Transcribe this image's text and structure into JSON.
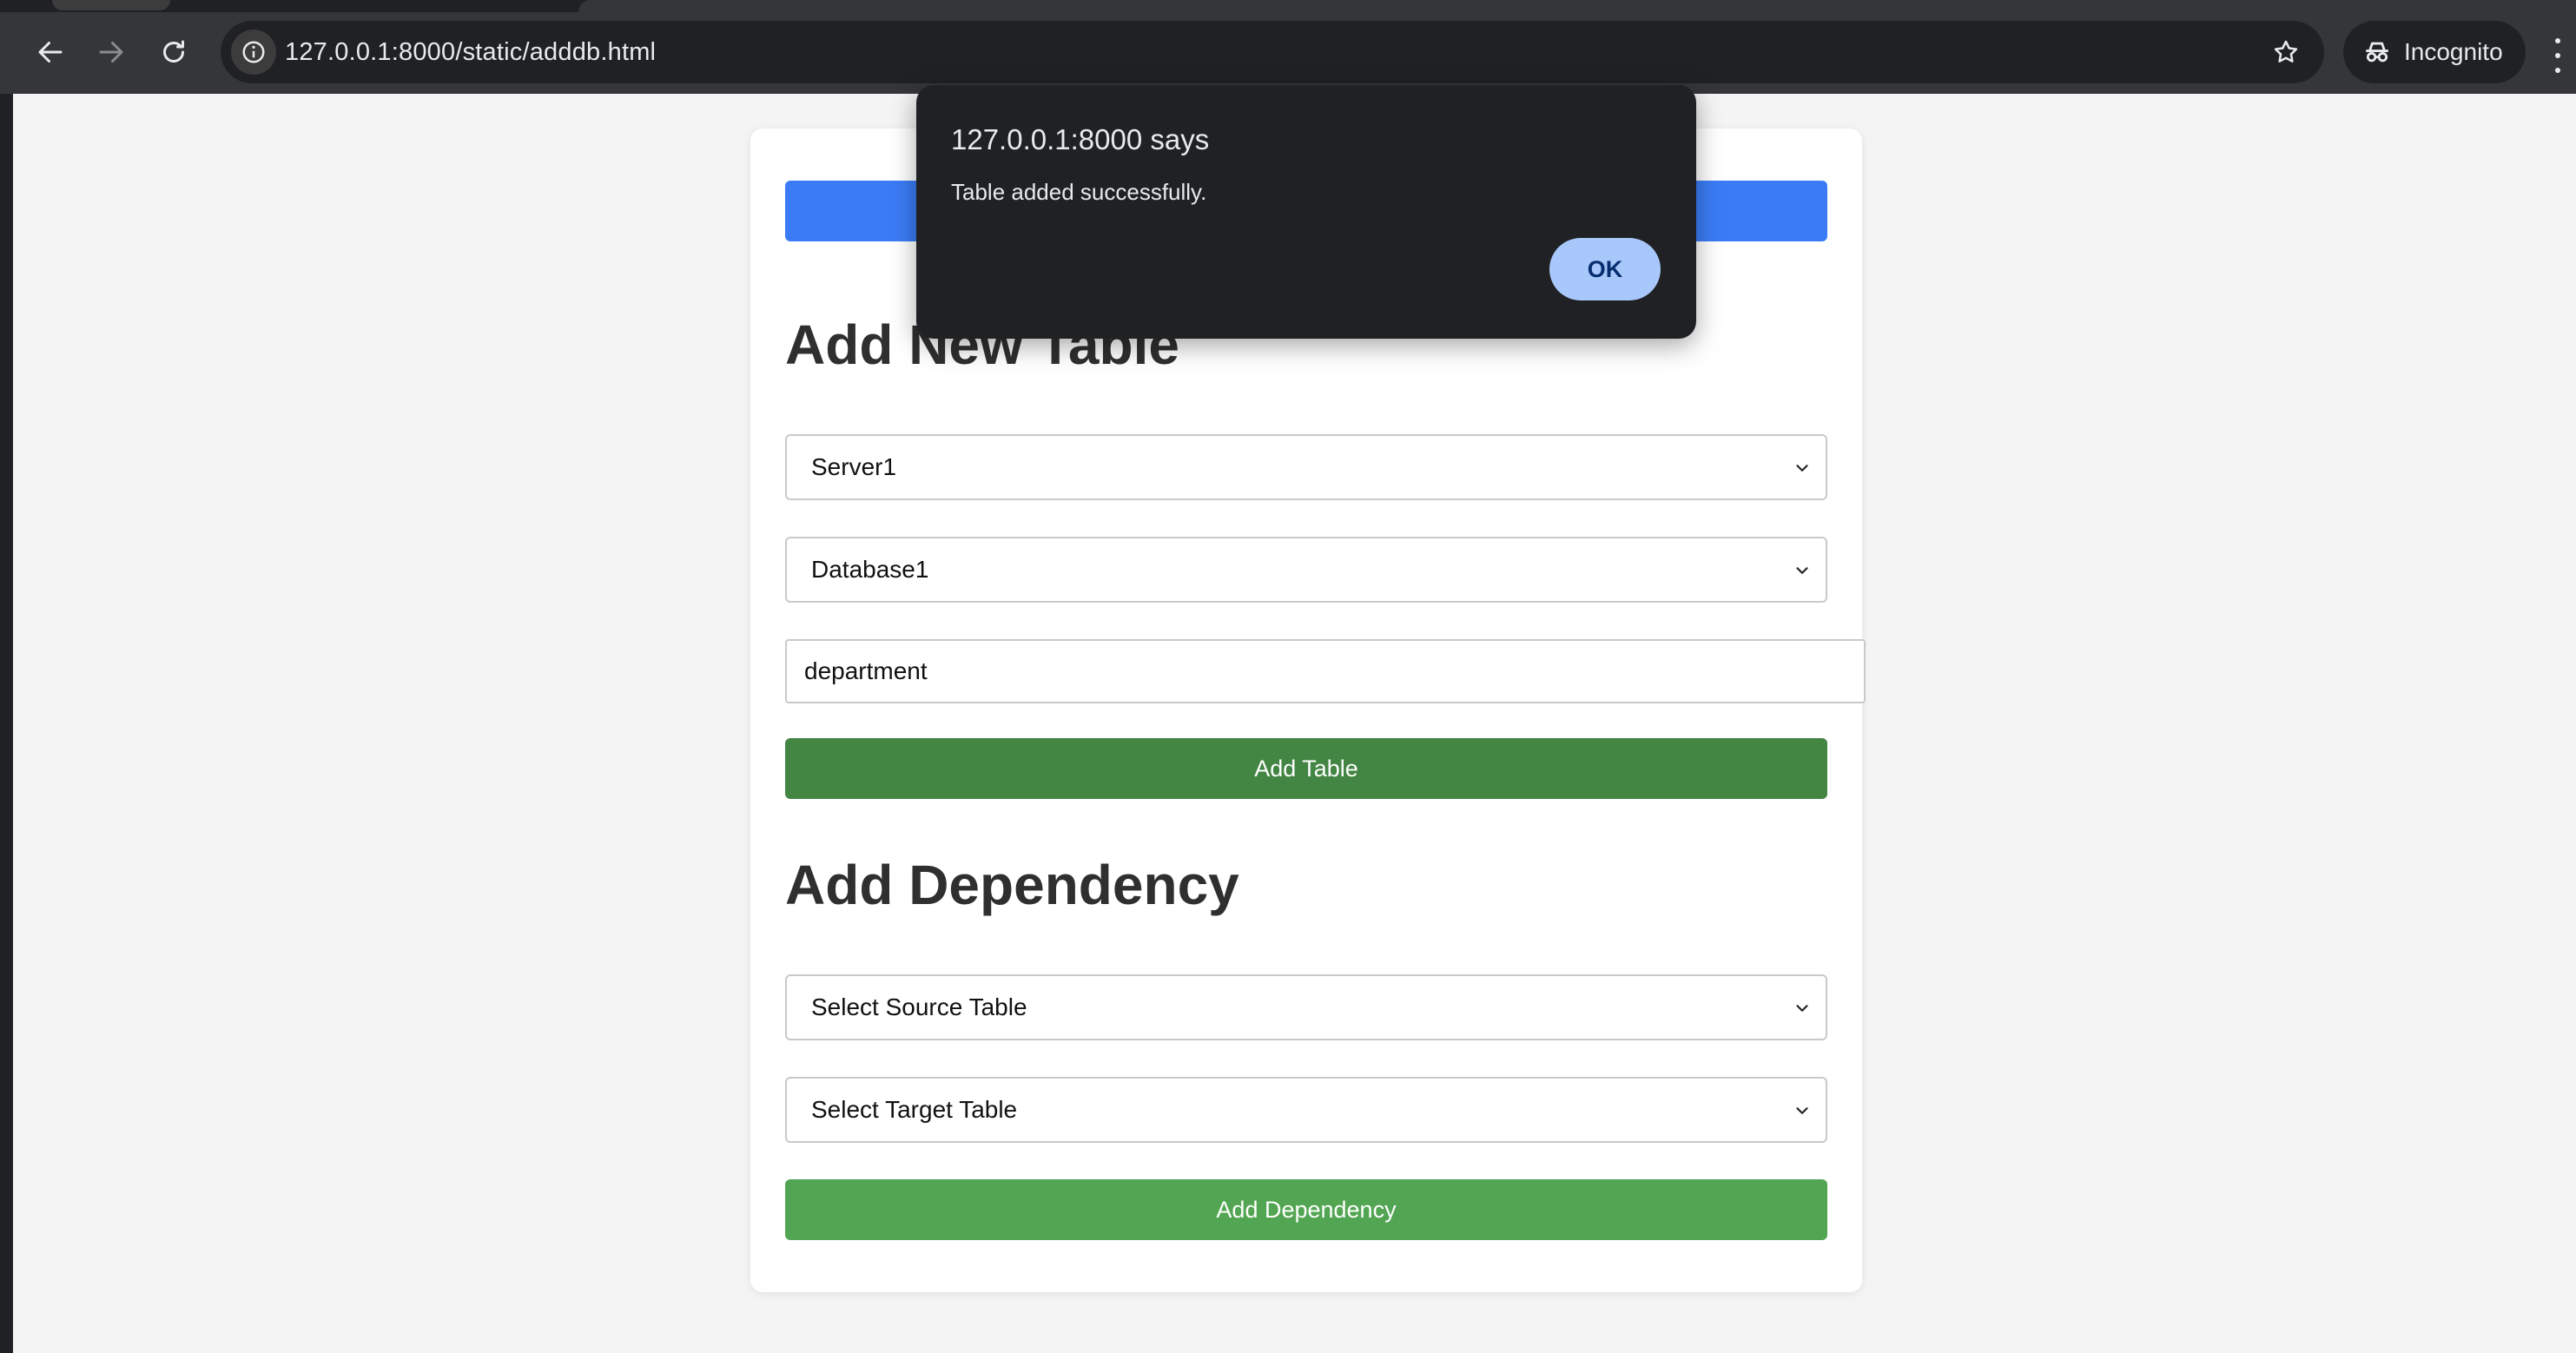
{
  "browser": {
    "url": "127.0.0.1:8000/static/adddb.html",
    "profile_label": "Incognito"
  },
  "dialog": {
    "title": "127.0.0.1:8000 says",
    "message": "Table added successfully.",
    "ok_label": "OK"
  },
  "add_table": {
    "heading": "Add New Table",
    "server_select": "Server1",
    "database_select": "Database1",
    "table_name_value": "department",
    "submit_label": "Add Table"
  },
  "add_dependency": {
    "heading": "Add Dependency",
    "source_select": "Select Source Table",
    "target_select": "Select Target Table",
    "submit_label": "Add Dependency"
  },
  "colors": {
    "primary_blue": "#3b7cf6",
    "add_table_green": "#438543",
    "add_dependency_green": "#52a552",
    "dialog_bg": "#202124",
    "ok_button": "#a8c7fa"
  }
}
